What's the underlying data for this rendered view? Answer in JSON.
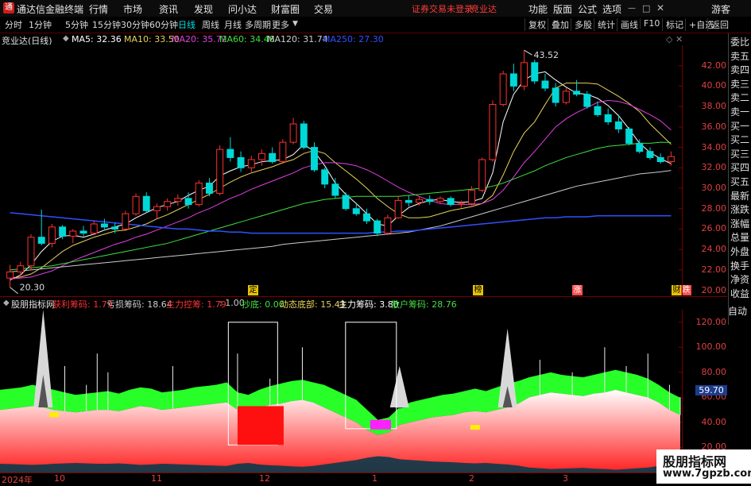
{
  "titlebar": {
    "app_title": "通达信金融终端",
    "menus": [
      "行情",
      "市场",
      "资讯",
      "发现",
      "问小达",
      "财富圈",
      "交易"
    ],
    "notice": "证券交易未登录",
    "stock_name": "竞业达",
    "right_menus": [
      "功能",
      "版面",
      "公式",
      "选项"
    ],
    "guest": "游客"
  },
  "toolbar": {
    "periods": [
      "分时",
      "1分钟",
      "5分钟",
      "15分钟",
      "30分钟",
      "60分钟",
      "日线",
      "周线",
      "月线",
      "多周期",
      "更多"
    ],
    "active_period": "日线",
    "buttons": [
      "复权",
      "叠加",
      "多股",
      "统计",
      "画线",
      "F10",
      "标记",
      "+自选",
      "返回"
    ]
  },
  "infobar": {
    "title": "竞业达(日线)",
    "items": [
      {
        "label": "MA5: 32.36",
        "color": "#ffffff"
      },
      {
        "label": "MA10: 33.50",
        "color": "#e6d25a"
      },
      {
        "label": "MA20: 35.72",
        "color": "#e040e0"
      },
      {
        "label": "MA60: 34.48",
        "color": "#40e040"
      },
      {
        "label": "MA120: 31.74",
        "color": "#cccccc"
      },
      {
        "label": "MA250: 27.30",
        "color": "#3050ff"
      }
    ]
  },
  "main_axis": {
    "ticks": [
      "42.00",
      "40.00",
      "38.00",
      "36.00",
      "34.00",
      "32.00",
      "30.00",
      "28.00",
      "26.00",
      "24.00",
      "22.00",
      "20.00"
    ]
  },
  "annotations": {
    "high": "43.52",
    "low": "20.30"
  },
  "events": [
    "定",
    "榜",
    "涨",
    "财",
    "跌"
  ],
  "side_panel": [
    "委比",
    "卖五",
    "卖四",
    "卖三",
    "卖二",
    "卖一",
    "买一",
    "买二",
    "买三",
    "买四",
    "买五",
    "最新",
    "涨跌",
    "涨幅",
    "总量",
    "外盘",
    "换手",
    "净资",
    "收益"
  ],
  "auto_button": "自动",
  "indbar": {
    "name": "股朋指标网",
    "items": [
      {
        "label": "获利筹码: 1.79",
        "color": "#ff3030"
      },
      {
        "label": "亏损筹码: 18.64",
        "color": "#cccccc"
      },
      {
        "label": "主力控筹: 1.79",
        "color": "#ff3030"
      },
      {
        "label": ": 1.00",
        "color": "#cccccc"
      },
      {
        "label": "抄底: 0.00",
        "color": "#40e040"
      },
      {
        "label": "动态底部: 15.43",
        "color": "#e6d25a"
      },
      {
        "label": "主力筹码: 3.80",
        "color": "#ffffff"
      },
      {
        "label": "散户筹码: 28.76",
        "color": "#40e040"
      }
    ]
  },
  "ind_axis": {
    "ticks": [
      "120.00",
      "100.00",
      "80.00",
      "60.00",
      "40.00",
      "20.00"
    ],
    "current": "59.70"
  },
  "dates": [
    "2024年",
    "10",
    "11",
    "12",
    "1",
    "2",
    "3"
  ],
  "watermark": {
    "line1": "股朋指标网",
    "line2": "www.7gpzb.com"
  },
  "colors": {
    "up": "#ff3030",
    "down": "#00d8d8",
    "grid": "#7a0000"
  },
  "chart_data": [
    {
      "type": "candlestick",
      "ylim": [
        19.5,
        44
      ],
      "yticks": [
        42,
        40,
        38,
        36,
        34,
        32,
        30,
        28,
        26,
        24,
        22,
        20
      ],
      "series": [
        {
          "name": "MA5",
          "values": [
            21,
            21.5,
            22.5,
            23.8,
            24.8,
            25.3,
            25.4,
            25.2,
            25.5,
            25.9,
            26.2,
            26.5,
            27.1,
            27.6,
            28.1,
            28.4,
            28.7,
            29.3,
            29.8,
            30.2,
            31.2,
            31.7,
            32.1,
            32.3,
            32.6,
            32.7,
            32.8,
            33.3,
            34.3,
            33.6,
            32.2,
            30.5,
            29.4,
            28.5,
            27.5,
            26.5,
            26.3,
            27.3,
            28.1,
            28.5,
            28.8,
            28.9,
            28.7,
            28.6,
            28.7,
            29,
            31.5,
            36.5,
            39.2,
            40.6,
            41.2,
            41.4,
            40.6,
            39.9,
            39.3,
            39.2,
            38.8,
            38.1,
            37.1,
            35.8,
            34.4,
            33.5,
            32.9,
            32.4
          ]
        },
        {
          "name": "MA10",
          "values": [
            21.2,
            21.3,
            21.6,
            22.2,
            23,
            23.8,
            24.4,
            24.8,
            25.2,
            25.5,
            25.8,
            25.9,
            26.2,
            26.5,
            27,
            27.4,
            27.9,
            28.4,
            28.9,
            29.4,
            30,
            30.6,
            31.1,
            31.5,
            31.8,
            32.1,
            32.5,
            32.8,
            33.4,
            33.7,
            33.4,
            32.5,
            31.7,
            30.9,
            30,
            29,
            28.2,
            27.5,
            27.1,
            27.1,
            27.2,
            27.5,
            27.8,
            28,
            28.2,
            28.5,
            29.3,
            31.3,
            33.6,
            35.4,
            36.5,
            38.2,
            39.8,
            40.3,
            40.3,
            40.3,
            40.2,
            39.6,
            39,
            38.3,
            37.5,
            36.3,
            35.3,
            34.3
          ]
        },
        {
          "name": "MA20",
          "values": [
            21.1,
            21.2,
            21.3,
            21.6,
            21.9,
            22.4,
            22.9,
            23.3,
            23.7,
            24.1,
            24.5,
            24.8,
            25.2,
            25.5,
            25.9,
            26.3,
            26.7,
            27.1,
            27.6,
            28,
            28.5,
            29,
            29.4,
            29.9,
            30.3,
            30.7,
            31.1,
            31.5,
            32,
            32.3,
            32.5,
            32.5,
            32.4,
            32.2,
            31.8,
            31.3,
            30.7,
            30.1,
            29.6,
            29.2,
            28.8,
            28.5,
            28.4,
            28.4,
            28.4,
            28.5,
            28.9,
            29.8,
            31.1,
            32.5,
            33.6,
            34.8,
            36,
            36.8,
            37.4,
            37.9,
            38.4,
            38.6,
            38.5,
            38.2,
            37.7,
            37.2,
            36.6,
            35.7
          ]
        },
        {
          "name": "MA60",
          "values": [
            22,
            22.1,
            22.2,
            22.3,
            22.4,
            22.6,
            22.8,
            23,
            23.2,
            23.4,
            23.6,
            23.8,
            24,
            24.2,
            24.4,
            24.6,
            24.9,
            25.2,
            25.5,
            25.8,
            26.1,
            26.4,
            26.7,
            27,
            27.3,
            27.6,
            27.9,
            28.2,
            28.5,
            28.7,
            28.9,
            29,
            29.1,
            29.2,
            29.2,
            29.2,
            29.2,
            29.2,
            29.3,
            29.4,
            29.5,
            29.6,
            29.7,
            29.8,
            29.9,
            30,
            30.2,
            30.5,
            30.9,
            31.3,
            31.7,
            32.2,
            32.6,
            33,
            33.3,
            33.6,
            33.9,
            34.1,
            34.2,
            34.3,
            34.4,
            34.4,
            34.5,
            34.48
          ]
        },
        {
          "name": "MA120",
          "values": [
            21.8,
            21.9,
            22,
            22.1,
            22.2,
            22.3,
            22.4,
            22.5,
            22.6,
            22.7,
            22.8,
            22.9,
            23,
            23.1,
            23.2,
            23.3,
            23.4,
            23.5,
            23.6,
            23.7,
            23.8,
            23.9,
            24,
            24.1,
            24.2,
            24.3,
            24.5,
            24.6,
            24.7,
            24.8,
            24.9,
            25,
            25.1,
            25.2,
            25.3,
            25.4,
            25.5,
            25.6,
            25.7,
            25.9,
            26.1,
            26.3,
            26.6,
            26.9,
            27.2,
            27.5,
            27.8,
            28.1,
            28.4,
            28.7,
            29,
            29.3,
            29.6,
            29.9,
            30.2,
            30.4,
            30.6,
            30.8,
            31,
            31.2,
            31.4,
            31.5,
            31.6,
            31.74
          ]
        },
        {
          "name": "MA250",
          "values": [
            27.6,
            27.5,
            27.4,
            27.3,
            27.2,
            27.1,
            27,
            26.9,
            26.8,
            26.7,
            26.6,
            26.5,
            26.4,
            26.3,
            26.2,
            26.1,
            26,
            26,
            25.9,
            25.8,
            25.8,
            25.7,
            25.7,
            25.6,
            25.6,
            25.6,
            25.6,
            25.6,
            25.6,
            25.6,
            25.6,
            25.6,
            25.6,
            25.6,
            25.6,
            25.7,
            25.7,
            25.8,
            25.8,
            25.9,
            26,
            26.1,
            26.2,
            26.3,
            26.4,
            26.5,
            26.6,
            26.7,
            26.8,
            26.9,
            27,
            27.1,
            27.1,
            27.2,
            27.2,
            27.2,
            27.3,
            27.3,
            27.3,
            27.3,
            27.3,
            27.3,
            27.3,
            27.3
          ]
        }
      ],
      "candles": [
        [
          21.2,
          22.5,
          20.3,
          21.8
        ],
        [
          21.8,
          22.8,
          21.2,
          22.4
        ],
        [
          22.4,
          25.5,
          22,
          25.2
        ],
        [
          25.2,
          27.9,
          24.4,
          24.6
        ],
        [
          24.6,
          26.5,
          24.2,
          26.2
        ],
        [
          26.2,
          26.4,
          25,
          25.3
        ],
        [
          25.3,
          26,
          24.6,
          25.8
        ],
        [
          25.8,
          26.3,
          25.3,
          25.6
        ],
        [
          25.6,
          26.8,
          25.4,
          26.5
        ],
        [
          26.5,
          27,
          26,
          26.2
        ],
        [
          26.2,
          26.6,
          25.6,
          26
        ],
        [
          26,
          27.8,
          25.8,
          27.5
        ],
        [
          27.5,
          29.5,
          27.3,
          29.2
        ],
        [
          29.2,
          29.6,
          27.6,
          27.8
        ],
        [
          27.8,
          28.5,
          27,
          28.2
        ],
        [
          28.2,
          29,
          27.8,
          28.7
        ],
        [
          28.7,
          29.4,
          28.3,
          29
        ],
        [
          29,
          29.6,
          28,
          28.4
        ],
        [
          28.4,
          30.8,
          28.2,
          30.5
        ],
        [
          30.5,
          31,
          29.2,
          29.5
        ],
        [
          29.5,
          34.2,
          29.3,
          33.8
        ],
        [
          33.8,
          35,
          32.6,
          33
        ],
        [
          33,
          33.6,
          31.6,
          32
        ],
        [
          32,
          33.2,
          31.6,
          32.8
        ],
        [
          32.8,
          33.8,
          32.2,
          33.4
        ],
        [
          33.4,
          34,
          32.4,
          32.6
        ],
        [
          32.6,
          34.8,
          32.4,
          34.5
        ],
        [
          34.5,
          36.9,
          34.3,
          36.3
        ],
        [
          36.3,
          36.6,
          33.8,
          34
        ],
        [
          34,
          34.5,
          31.6,
          31.8
        ],
        [
          31.8,
          32,
          30,
          30.4
        ],
        [
          30.4,
          31,
          29,
          29.3
        ],
        [
          29.3,
          29.6,
          27.8,
          28
        ],
        [
          28,
          28.5,
          27.3,
          27.5
        ],
        [
          27.5,
          28,
          26.5,
          26.8
        ],
        [
          26.8,
          27,
          25.3,
          25.6
        ],
        [
          25.6,
          27.4,
          25.4,
          27.1
        ],
        [
          27.1,
          29.2,
          27,
          28.8
        ],
        [
          28.8,
          29.3,
          28.2,
          28.6
        ],
        [
          28.6,
          29.2,
          28.3,
          28.9
        ],
        [
          28.9,
          29.3,
          28.4,
          28.7
        ],
        [
          28.7,
          29.2,
          28.5,
          29
        ],
        [
          29,
          29.2,
          28.2,
          28.4
        ],
        [
          28.4,
          28.8,
          28.1,
          28.5
        ],
        [
          28.5,
          30.2,
          28.3,
          29.8
        ],
        [
          29.8,
          33,
          29.6,
          32.8
        ],
        [
          32.8,
          38.6,
          32.6,
          38.2
        ],
        [
          38.2,
          41.5,
          38,
          41.2
        ],
        [
          41.2,
          42.2,
          39.5,
          40
        ],
        [
          40,
          43.52,
          39.6,
          42.3
        ],
        [
          42.3,
          42.6,
          40.2,
          40.5
        ],
        [
          40.5,
          41.2,
          39.5,
          39.8
        ],
        [
          39.8,
          40.3,
          38,
          38.4
        ],
        [
          38.4,
          39.8,
          38.2,
          39.5
        ],
        [
          39.5,
          40.6,
          39,
          39.2
        ],
        [
          39.2,
          39.5,
          37.8,
          38
        ],
        [
          38,
          38.5,
          37,
          37.2
        ],
        [
          37.2,
          37.8,
          36.2,
          36.5
        ],
        [
          36.5,
          37.2,
          35.4,
          35.8
        ],
        [
          35.8,
          36,
          34.2,
          34.4
        ],
        [
          34.4,
          34.8,
          33.4,
          33.6
        ],
        [
          33.6,
          34,
          32.8,
          33
        ],
        [
          33,
          33.4,
          32.4,
          32.6
        ],
        [
          32.6,
          33.6,
          32.2,
          33.1
        ]
      ]
    },
    {
      "type": "area",
      "ylim": [
        0,
        130
      ],
      "yticks": [
        120,
        100,
        80,
        60,
        40,
        20
      ],
      "series": [
        {
          "name": "获利筹码",
          "values": [
            50,
            51,
            52,
            53,
            52,
            50,
            49,
            48,
            49,
            50,
            50,
            49,
            51,
            53,
            52,
            50,
            51,
            52,
            53,
            54,
            55,
            56,
            50,
            48,
            52,
            54,
            55,
            57,
            58,
            56,
            52,
            48,
            44,
            40,
            34,
            30,
            32,
            38,
            40,
            42,
            44,
            45,
            46,
            48,
            49,
            48,
            50,
            52,
            55,
            60,
            62,
            64,
            63,
            62,
            61,
            63,
            64,
            66,
            64,
            62,
            60,
            56,
            50,
            46
          ]
        },
        {
          "name": "散户筹码",
          "values": [
            66,
            67,
            68,
            70,
            68,
            66,
            64,
            62,
            63,
            64,
            65,
            63,
            66,
            68,
            67,
            64,
            65,
            66,
            68,
            69,
            70,
            72,
            64,
            62,
            66,
            69,
            71,
            73,
            74,
            72,
            70,
            66,
            62,
            58,
            50,
            42,
            44,
            52,
            56,
            58,
            60,
            62,
            63,
            65,
            67,
            65,
            68,
            71,
            73,
            76,
            78,
            80,
            78,
            77,
            76,
            78,
            80,
            82,
            80,
            78,
            75,
            70,
            64,
            59.7
          ]
        }
      ]
    }
  ]
}
